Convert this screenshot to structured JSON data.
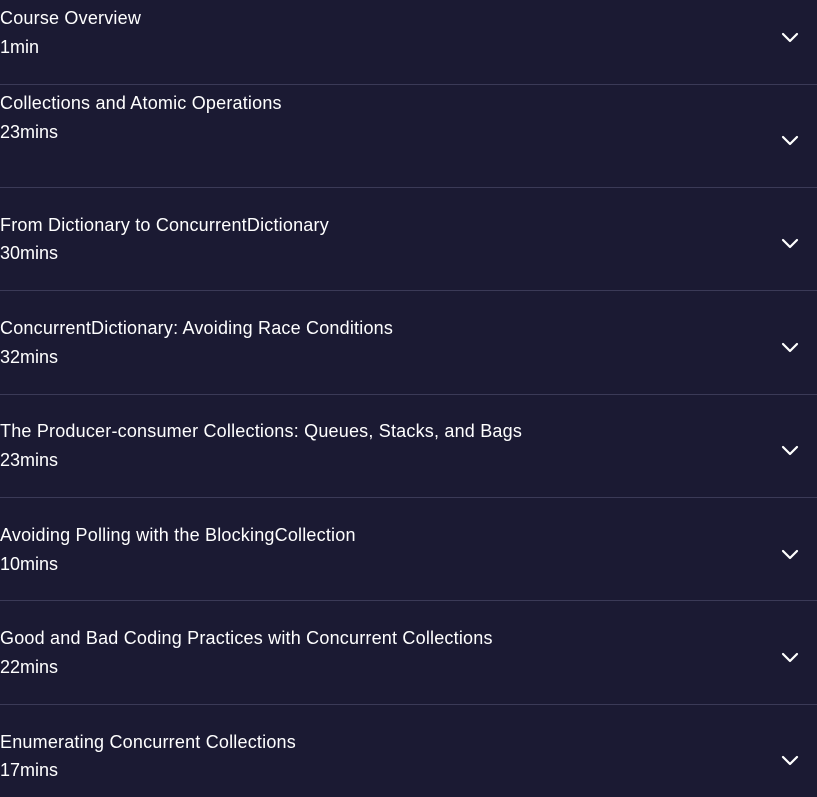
{
  "modules": [
    {
      "title": "Course Overview",
      "duration": "1min"
    },
    {
      "title": "Collections and Atomic Operations",
      "duration": "23mins"
    },
    {
      "title": "From Dictionary to ConcurrentDictionary",
      "duration": "30mins"
    },
    {
      "title": "ConcurrentDictionary: Avoiding Race Conditions",
      "duration": "32mins"
    },
    {
      "title": "The Producer-consumer Collections: Queues, Stacks, and Bags",
      "duration": "23mins"
    },
    {
      "title": "Avoiding Polling with the BlockingCollection",
      "duration": "10mins"
    },
    {
      "title": "Good and Bad Coding Practices with Concurrent Collections",
      "duration": "22mins"
    },
    {
      "title": "Enumerating Concurrent Collections",
      "duration": "17mins"
    }
  ],
  "icons": {
    "expand": "chevron-down-icon"
  },
  "colors": {
    "background": "#1b1a33",
    "divider": "#3b3a57",
    "text": "#ffffff"
  }
}
